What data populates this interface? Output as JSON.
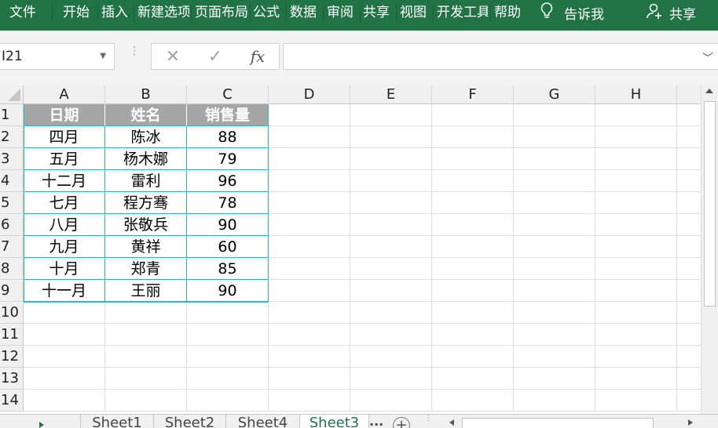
{
  "menu": [
    "文件",
    "开始",
    "插入",
    "新建选项卡",
    "页面布局",
    "公式",
    "数据",
    "审阅",
    "共享",
    "视图",
    "开发工具",
    "帮助"
  ],
  "tell_me": "告诉我",
  "share": "共享",
  "name_box": "I21",
  "columns": [
    "A",
    "B",
    "C",
    "D",
    "E",
    "F",
    "G",
    "H"
  ],
  "rows": [
    "1",
    "2",
    "3",
    "4",
    "5",
    "6",
    "7",
    "8",
    "9",
    "10",
    "11",
    "12",
    "13",
    "14"
  ],
  "table": {
    "headers": [
      "日期",
      "姓名",
      "销售量"
    ],
    "rows": [
      [
        "四月",
        "陈冰",
        "88"
      ],
      [
        "五月",
        "杨木娜",
        "79"
      ],
      [
        "十二月",
        "雷利",
        "96"
      ],
      [
        "七月",
        "程方骞",
        "78"
      ],
      [
        "八月",
        "张敬兵",
        "90"
      ],
      [
        "九月",
        "黄祥",
        "60"
      ],
      [
        "十月",
        "郑青",
        "85"
      ],
      [
        "十一月",
        "王丽",
        "90"
      ]
    ]
  },
  "sheets": [
    "Sheet1",
    "Sheet2",
    "Sheet4",
    "Sheet3"
  ],
  "active_sheet": "Sheet3",
  "colors": {
    "ribbon": "#217346",
    "header_fill": "#a6a6a6",
    "table_border": "#2bb5c9"
  }
}
